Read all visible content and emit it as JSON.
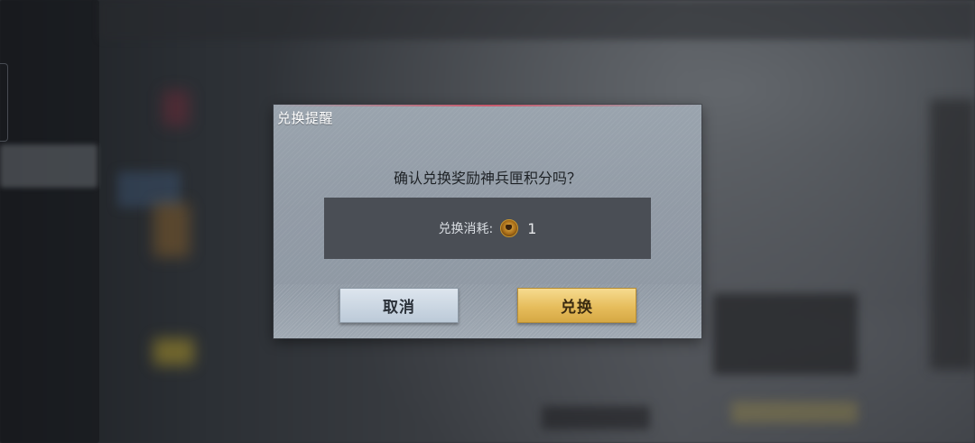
{
  "dialog": {
    "title": "兑换提醒",
    "question": "确认兑换奖励神兵匣积分吗？",
    "cost": {
      "label": "兑换消耗:",
      "icon": "bronze-medal-icon",
      "value": "1"
    },
    "buttons": {
      "cancel_label": "取消",
      "confirm_label": "兑换"
    }
  },
  "colors": {
    "dialog_bg": "#929ba6",
    "cost_box_bg": "#4a4e55",
    "cancel_button": "#c8d4e0",
    "confirm_button": "#e8c060",
    "title_accent": "#c85a6c"
  }
}
